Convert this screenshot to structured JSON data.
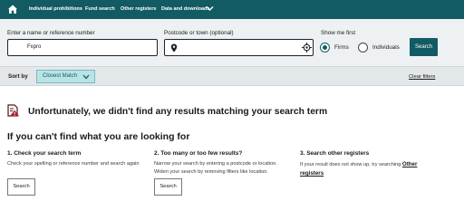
{
  "nav": {
    "items": [
      "Individual prohibitions",
      "Fund search",
      "Other registers",
      "Data and downloads"
    ]
  },
  "search": {
    "name_label": "Enter a name or reference number",
    "name_value": "Fxpro",
    "postcode_label": "Postcode or town (optional)",
    "postcode_value": "",
    "show_label": "Show me first",
    "option_firms": "Firms",
    "option_individuals": "Individuals",
    "selected_option": "Firms",
    "button": "Search"
  },
  "sort": {
    "label": "Sort by",
    "value": "Closest Match",
    "clear": "Clear filters"
  },
  "results": {
    "message": "Unfortunately, we didn't find any results matching your search term",
    "section_title": "If you can't find what you are looking for",
    "columns": [
      {
        "title": "1. Check your search term",
        "text": "Check your spelling or reference number and search again",
        "button": "Search"
      },
      {
        "title": "2. Too many or too few results?",
        "text": "Narrow your search by entering a postcode or location. Widen your search by removing filters like location.",
        "button": "Search"
      },
      {
        "title": "3. Search other registers",
        "text": "If your result does not show up, try searching",
        "link": "Other registers"
      }
    ]
  },
  "colors": {
    "brand": "#125b63",
    "sort_chip": "#b9e3e4"
  },
  "icons": [
    "home-icon",
    "chevron-down-icon",
    "location-pin-icon",
    "crosshair-icon",
    "warning-document-icon"
  ]
}
